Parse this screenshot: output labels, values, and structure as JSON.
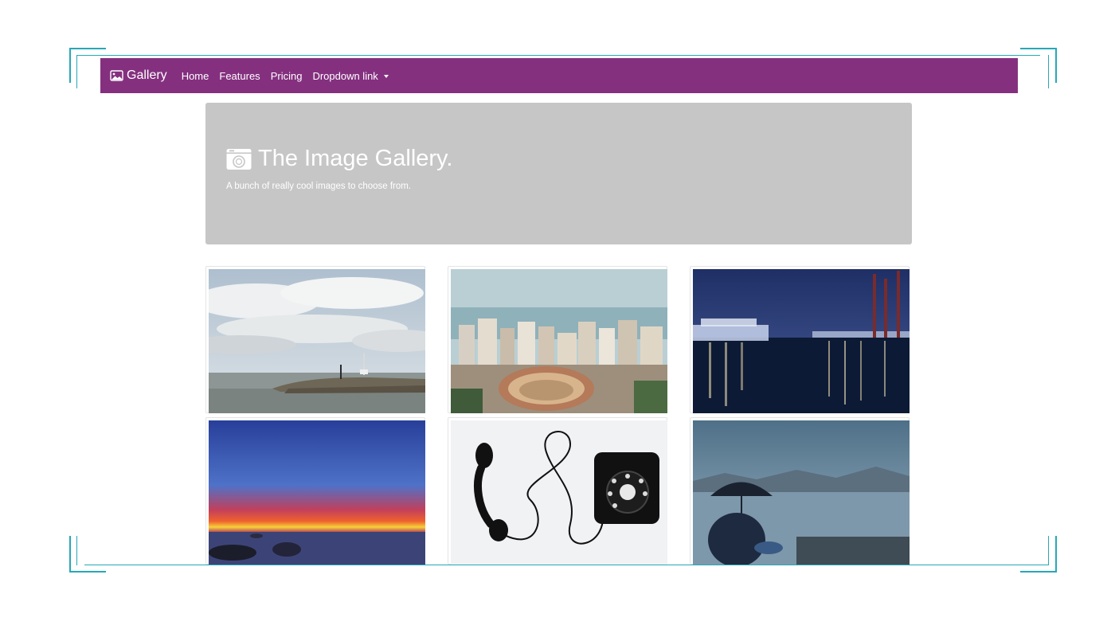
{
  "navbar": {
    "brand_label": "Gallery",
    "brand_icon": "image-icon",
    "items": [
      {
        "label": "Home"
      },
      {
        "label": "Features"
      },
      {
        "label": "Pricing"
      },
      {
        "label": "Dropdown link"
      }
    ],
    "dropdown_icon": "caret-down-icon",
    "background_color": "#84307f"
  },
  "jumbotron": {
    "icon": "camera-icon",
    "title": "The Image Gallery.",
    "lead": "A bunch of really cool images to choose from.",
    "background_color": "#c6c6c6"
  },
  "gallery": {
    "images": [
      {
        "subject": "cloudy-sky-pier-photo"
      },
      {
        "subject": "city-bullring-aerial-photo"
      },
      {
        "subject": "night-harbor-ship-photo"
      },
      {
        "subject": "sunset-sea-rocks-photo"
      },
      {
        "subject": "black-rotary-telephone-photo"
      },
      {
        "subject": "umbrella-by-sea-photo"
      }
    ]
  },
  "frame_color": "#27a8b8"
}
